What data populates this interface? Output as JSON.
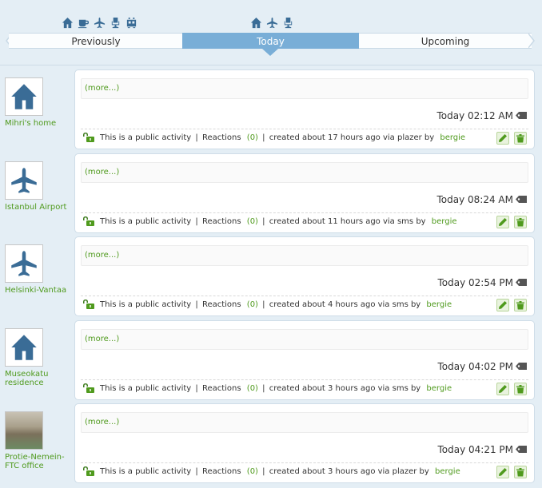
{
  "tabs": {
    "previous": "Previously",
    "today": "Today",
    "upcoming": "Upcoming"
  },
  "previous_icons": [
    "home-icon",
    "cafe-icon",
    "airplane-icon",
    "office-chair-icon",
    "tram-icon"
  ],
  "today_icons": [
    "home-icon",
    "airplane-icon",
    "office-chair-icon"
  ],
  "colors": {
    "accent": "#79aed7",
    "link": "#4f9a1d",
    "icon": "#3a6c96",
    "background": "#e4eef5"
  },
  "activities": [
    {
      "place": "Mihri's home",
      "place_icon": "home-icon",
      "more": "(more...)",
      "time": "Today 02:12 AM",
      "public": "This is a public activity",
      "reactions_label": "Reactions",
      "reactions_count": "(0)",
      "created": "created about 17 hours ago via plazer by",
      "author": "bergie"
    },
    {
      "place": "Istanbul Airport",
      "place_icon": "airplane-icon",
      "more": "(more...)",
      "time": "Today 08:24 AM",
      "public": "This is a public activity",
      "reactions_label": "Reactions",
      "reactions_count": "(0)",
      "created": "created about 11 hours ago via sms by",
      "author": "bergie"
    },
    {
      "place": "Helsinki-Vantaa",
      "place_icon": "airplane-icon",
      "more": "(more...)",
      "time": "Today 02:54 PM",
      "public": "This is a public activity",
      "reactions_label": "Reactions",
      "reactions_count": "(0)",
      "created": "created about 4 hours ago via sms by",
      "author": "bergie"
    },
    {
      "place": "Museokatu residence",
      "place_icon": "home-icon",
      "more": "(more...)",
      "time": "Today 04:02 PM",
      "public": "This is a public activity",
      "reactions_label": "Reactions",
      "reactions_count": "(0)",
      "created": "created about 3 hours ago via sms by",
      "author": "bergie"
    },
    {
      "place": "Protie-Nemein-FTC office",
      "place_icon": "building-photo",
      "more": "(more...)",
      "time": "Today 04:21 PM",
      "public": "This is a public activity",
      "reactions_label": "Reactions",
      "reactions_count": "(0)",
      "created": "created about 3 hours ago via plazer by",
      "author": "bergie"
    }
  ]
}
